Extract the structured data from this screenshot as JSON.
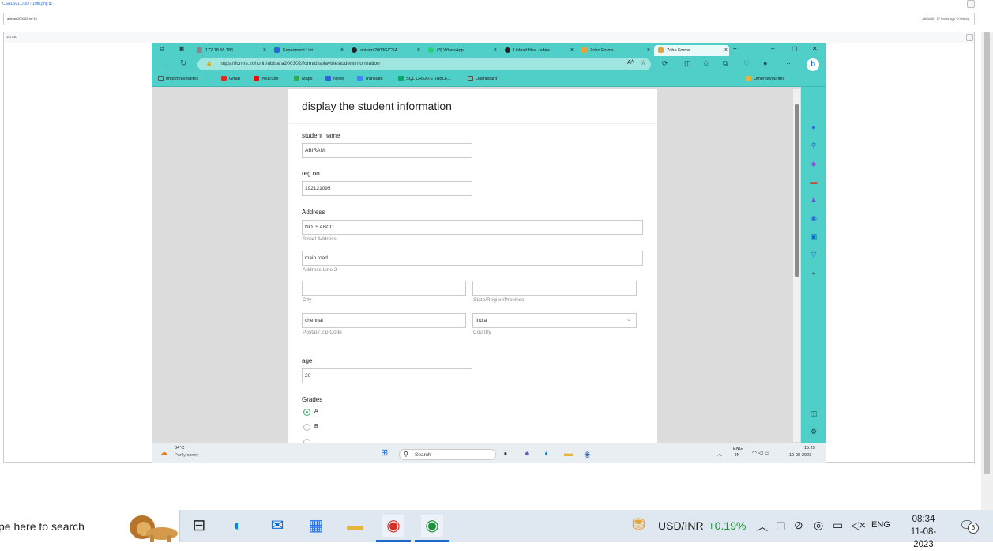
{
  "outer": {
    "breadcrumb_repo": "CSA1SCLOUD",
    "breadcrumb_file": "10th.png",
    "file_bar_left": "abirami200302 rn~10",
    "file_bar_right": "Abirla45 · 17 hours ago",
    "history_label": "History",
    "image_header_size": "111 KB"
  },
  "browser": {
    "tabs": [
      {
        "label": "172.18.56.186",
        "color": "#888"
      },
      {
        "label": "Experiment List",
        "color": "#2b65d9"
      },
      {
        "label": "abirami2003G/CSA",
        "color": "#222"
      },
      {
        "label": "(3) WhatsApp",
        "color": "#25d366"
      },
      {
        "label": "Upload files · abira",
        "color": "#222"
      },
      {
        "label": "Zoho Forms",
        "color": "#e8a23a"
      },
      {
        "label": "Zoho Forms",
        "color": "#e8a23a"
      }
    ],
    "url": "https://forms.zoho.in/abisara200302/form/displaythestudentinformation",
    "bookmarks": [
      {
        "label": "Import favourites",
        "color": "#555"
      },
      {
        "label": "Gmail",
        "color": "#d93025"
      },
      {
        "label": "YouTube",
        "color": "#ff0000"
      },
      {
        "label": "Maps",
        "color": "#34a853"
      },
      {
        "label": "News",
        "color": "#2b65d9"
      },
      {
        "label": "Translate",
        "color": "#4285f4"
      },
      {
        "label": "SQL CREATE TABLE...",
        "color": "#04aa6d"
      },
      {
        "label": "Dashboard",
        "color": "#555"
      }
    ],
    "other_favourites": "Other favourites"
  },
  "form": {
    "title": "display the student information",
    "student_name_label": "student name",
    "student_name_value": "ABIRAMI",
    "reg_no_label": "reg no",
    "reg_no_value": "192121095",
    "address_label": "Address",
    "street_value": "NO. 5 ABCD",
    "street_sub": "Street Address",
    "line2_value": "main road",
    "line2_sub": "Address Line 2",
    "city_sub": "City",
    "state_sub": "State/Region/Province",
    "postal_value": "chennai",
    "postal_sub": "Postal / Zip Code",
    "country_value": "India",
    "country_sub": "Country",
    "age_label": "age",
    "age_value": "20",
    "grades_label": "Grades",
    "grade_a": "A",
    "grade_b": "B",
    "grade_selected": "A"
  },
  "inner_taskbar": {
    "weather_temp": "34°C",
    "weather_desc": "Partly sunny",
    "search": "Search",
    "lang_top": "ENG",
    "lang_bottom": "IN",
    "time": "15:25",
    "date": "10-08-2023"
  },
  "taskbar": {
    "search_text": "pe here to search",
    "currency": "USD/INR",
    "currency_change": "+0.19%",
    "lang": "ENG",
    "time": "08:34",
    "date": "11-08-2023",
    "notifications": "3"
  }
}
